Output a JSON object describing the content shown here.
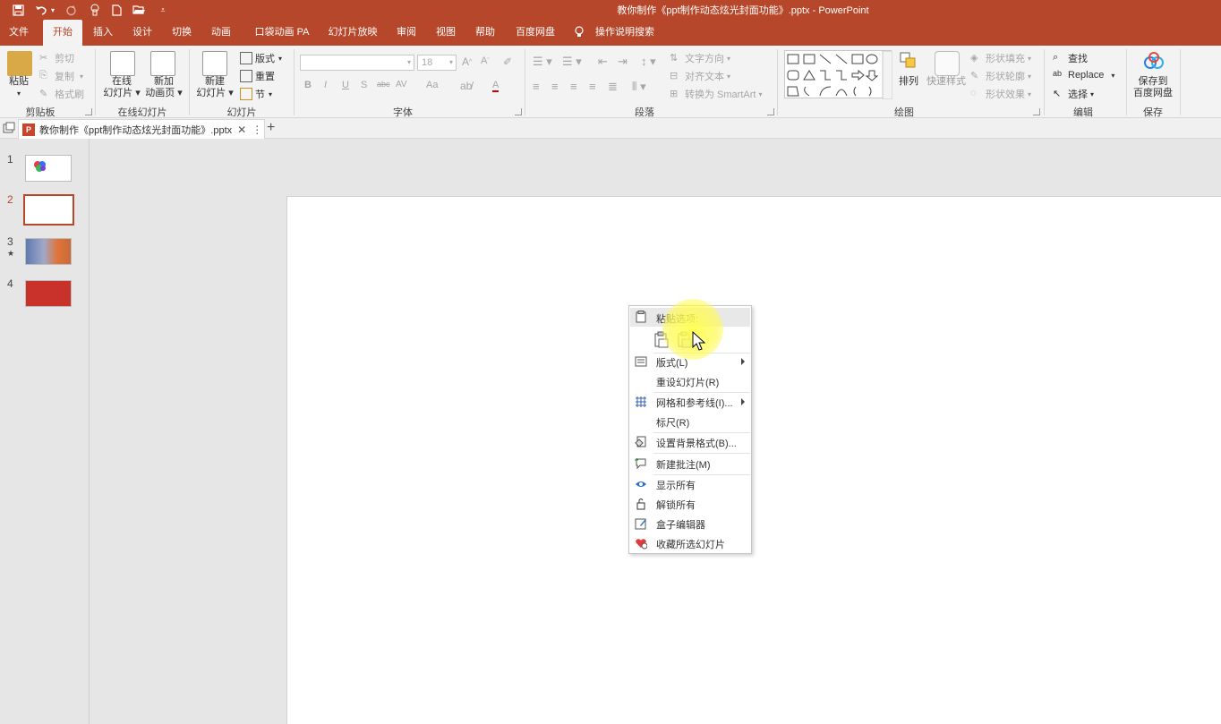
{
  "titlebar": {
    "title": "教你制作《ppt制作动态炫光封面功能》.pptx  -  PowerPoint",
    "qa_icons": [
      "save-icon",
      "undo-icon",
      "redo-icon",
      "touch-mode-icon",
      "new-icon",
      "open-icon",
      "customize-icon"
    ]
  },
  "tabs": [
    "文件",
    "开始",
    "插入",
    "设计",
    "切换",
    "动画",
    "口袋动画 PA",
    "幻灯片放映",
    "审阅",
    "视图",
    "帮助",
    "百度网盘",
    "操作说明搜索"
  ],
  "ribbon": {
    "clipboard": {
      "paste": "粘贴",
      "cut": "剪切",
      "copy": "复制",
      "format_painter": "格式刷",
      "label": "剪贴板"
    },
    "online": {
      "online_slides_1": "在线",
      "online_slides_2": "幻灯片",
      "new_anim_1": "新加",
      "new_anim_2": "动画页",
      "label": "在线幻灯片"
    },
    "slides": {
      "new_slide_1": "新建",
      "new_slide_2": "幻灯片",
      "layout": "版式",
      "reset": "重置",
      "section": "节",
      "label": "幻灯片"
    },
    "font": {
      "size": "18",
      "label": "字体",
      "bold": "B",
      "italic": "I",
      "underline": "U",
      "shadow": "S",
      "strike": "abc",
      "spacing": "AV",
      "case": "Aa",
      "color": "A"
    },
    "paragraph": {
      "text_direction": "文字方向",
      "align_text": "对齐文本",
      "convert_smartart": "转换为 SmartArt",
      "label": "段落"
    },
    "drawing": {
      "arrange": "排列",
      "quick_styles": "快速样式",
      "shape_fill": "形状填充",
      "shape_outline": "形状轮廓",
      "shape_effects": "形状效果",
      "label": "绘图"
    },
    "editing": {
      "find": "查找",
      "replace": "Replace",
      "select": "选择",
      "label": "编辑"
    },
    "save": {
      "save_1": "保存到",
      "save_2": "百度网盘",
      "label": "保存"
    }
  },
  "doc_tab": {
    "title": "教你制作《ppt制作动态炫光封面功能》.pptx"
  },
  "thumbnails": [
    {
      "num": "1",
      "selected": false
    },
    {
      "num": "2",
      "selected": true
    },
    {
      "num": "3",
      "selected": false,
      "star": "★"
    },
    {
      "num": "4",
      "selected": false
    }
  ],
  "context_menu": {
    "paste_options": "粘贴选项:",
    "items": [
      {
        "label": "版式(L)",
        "icon": "layout-icon",
        "submenu": true
      },
      {
        "label": "重设幻灯片(R)",
        "icon": "",
        "submenu": false
      },
      {
        "label": "网格和参考线(I)...",
        "icon": "grid-icon",
        "submenu": true
      },
      {
        "label": "标尺(R)",
        "icon": "",
        "submenu": false
      },
      {
        "label": "设置背景格式(B)...",
        "icon": "format-background-icon",
        "submenu": false
      },
      {
        "label": "新建批注(M)",
        "icon": "new-comment-icon",
        "submenu": false
      },
      {
        "label": "显示所有",
        "icon": "eye-icon",
        "submenu": false
      },
      {
        "label": "解锁所有",
        "icon": "unlock-icon",
        "submenu": false
      },
      {
        "label": "盒子编辑器",
        "icon": "edit-icon",
        "submenu": false
      },
      {
        "label": "收藏所选幻灯片",
        "icon": "heart-icon",
        "submenu": false
      }
    ]
  },
  "colors": {
    "accent": "#b7472a",
    "ribbon_bg": "#f3f3f3",
    "workspace_bg": "#e6e6e6"
  }
}
